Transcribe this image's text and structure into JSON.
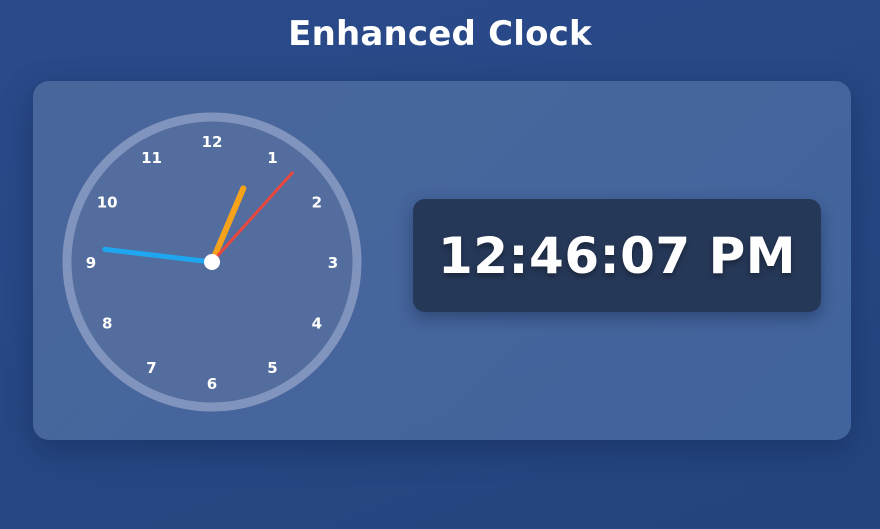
{
  "page": {
    "title": "Enhanced Clock"
  },
  "clock": {
    "numbers": [
      "12",
      "1",
      "2",
      "3",
      "4",
      "5",
      "6",
      "7",
      "8",
      "9",
      "10",
      "11"
    ],
    "time": {
      "hours": 12,
      "minutes": 46,
      "seconds": 7
    },
    "hand_colors": {
      "hour": "#f7a21b",
      "minute": "#1ea7f0",
      "second": "#e8473f",
      "center": "#ffffff"
    }
  },
  "digital": {
    "time_text": "12:46:07 PM"
  }
}
